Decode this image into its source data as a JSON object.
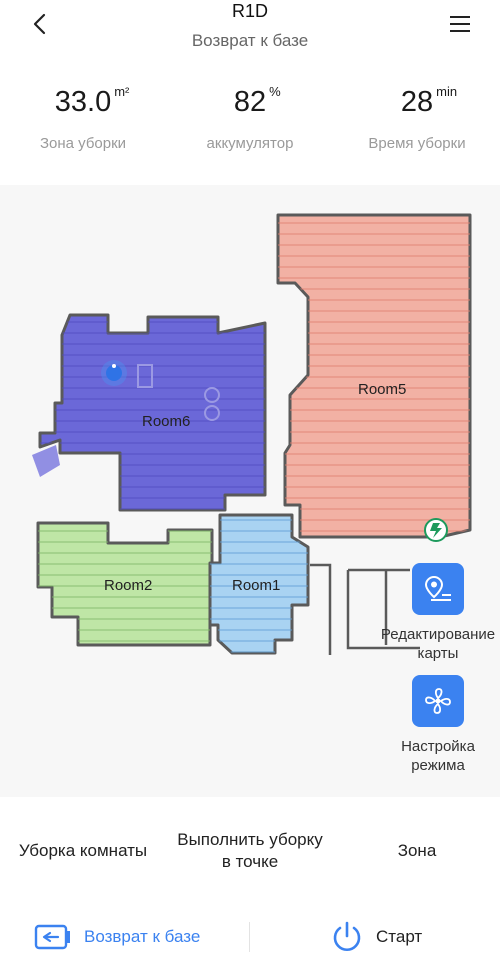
{
  "header": {
    "title": "R1D",
    "subtitle": "Возврат к базе"
  },
  "stats": [
    {
      "value": "33.0",
      "unit": "m²",
      "label": "Зона уборки"
    },
    {
      "value": "82",
      "unit": "%",
      "label": "аккумулятор"
    },
    {
      "value": "28",
      "unit": "min",
      "label": "Время уборки"
    }
  ],
  "map": {
    "rooms": [
      "Room6",
      "Room5",
      "Room2",
      "Room1"
    ],
    "room_colors": {
      "Room6": "#6b68d8",
      "Room5": "#f2b1a4",
      "Room2": "#bfe6a6",
      "Room1": "#a9d3f2"
    },
    "edit_map_label": "Редактирование карты",
    "mode_settings_label": "Настройка режима"
  },
  "modes": [
    "Уборка комнаты",
    "Выполнить уборку в точке",
    "Зона"
  ],
  "actions": {
    "return_label": "Возврат к базе",
    "start_label": "Старт"
  },
  "colors": {
    "accent": "#3b82f0",
    "wall": "#5a5a5a"
  }
}
